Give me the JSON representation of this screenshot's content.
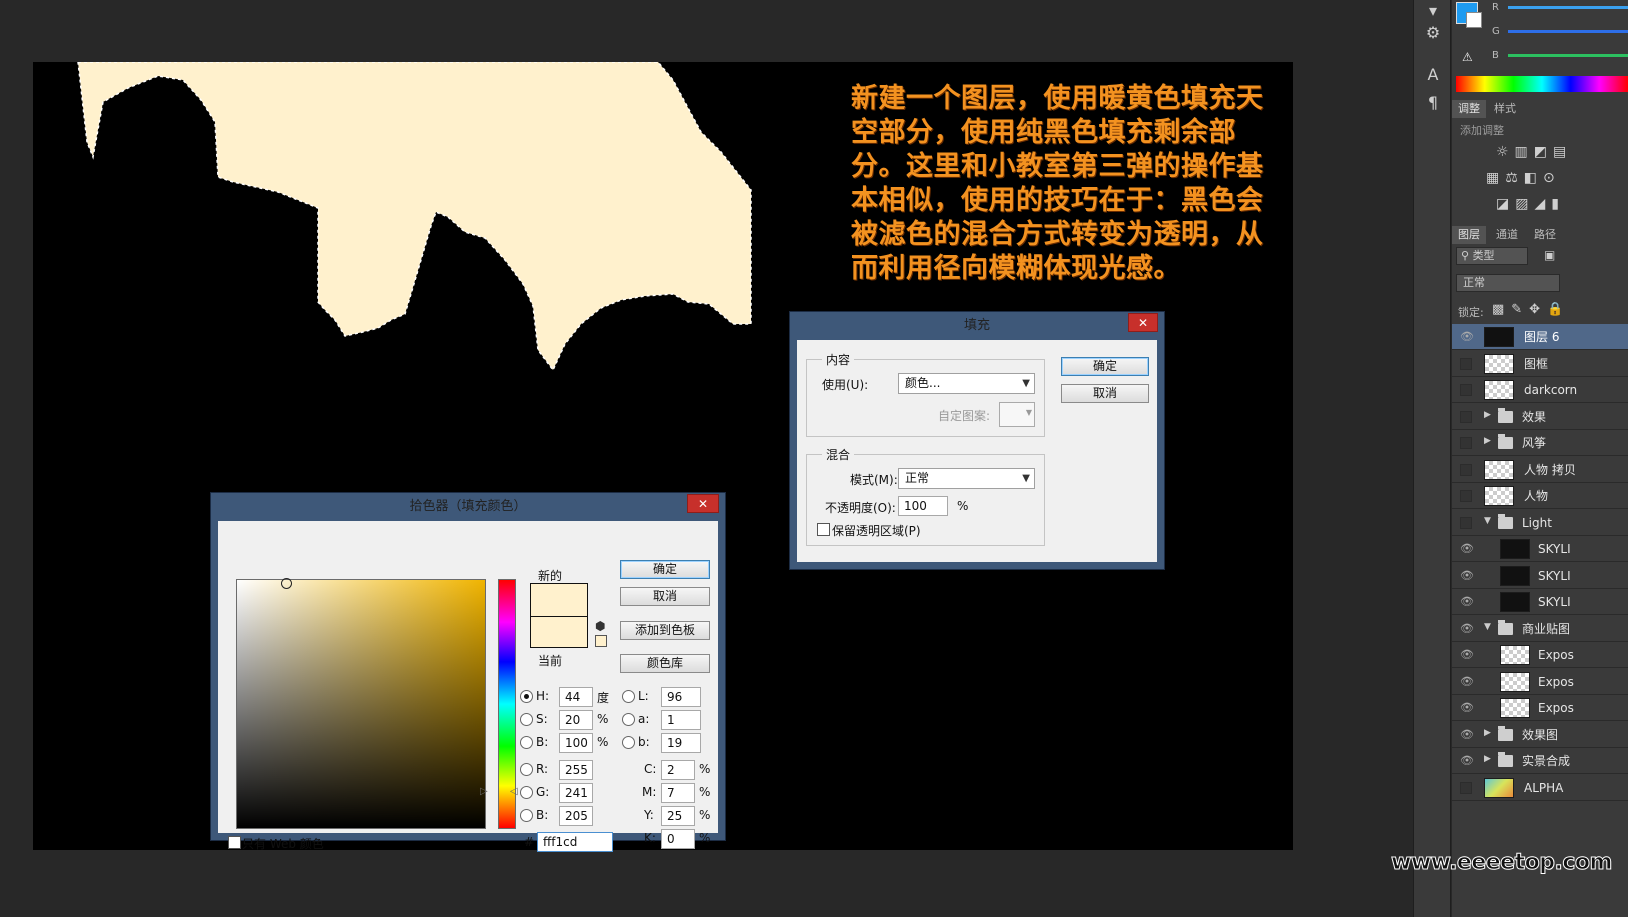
{
  "annotation": {
    "text": "新建一个图层，使用暖黄色填充天空部分，使用纯黑色填充剩余部分。这里和小教室第三弹的操作基本相似，使用的技巧在于：黑色会被滤色的混合方式转变为透明，从而利用径向模糊体现光感。"
  },
  "canvas": {
    "sky_color": "#fff1cd",
    "fill_color": "#000000"
  },
  "color_picker": {
    "title": "拾色器（填充颜色）",
    "close": "✕",
    "new_label": "新的",
    "current_label": "当前",
    "buttons": {
      "ok": "确定",
      "cancel": "取消",
      "add_to_swatches": "添加到色板",
      "color_libraries": "颜色库"
    },
    "fields": {
      "H": {
        "label": "H:",
        "value": "44",
        "unit": "度"
      },
      "S": {
        "label": "S:",
        "value": "20",
        "unit": "%"
      },
      "Bv": {
        "label": "B:",
        "value": "100",
        "unit": "%"
      },
      "R": {
        "label": "R:",
        "value": "255"
      },
      "G": {
        "label": "G:",
        "value": "241"
      },
      "B": {
        "label": "B:",
        "value": "205"
      },
      "L": {
        "label": "L:",
        "value": "96"
      },
      "a": {
        "label": "a:",
        "value": "1"
      },
      "b": {
        "label": "b:",
        "value": "19"
      },
      "C": {
        "label": "C:",
        "value": "2",
        "unit": "%"
      },
      "M": {
        "label": "M:",
        "value": "7",
        "unit": "%"
      },
      "Y": {
        "label": "Y:",
        "value": "25",
        "unit": "%"
      },
      "K": {
        "label": "K:",
        "value": "0",
        "unit": "%"
      }
    },
    "hex_label": "#",
    "hex_value": "fff1cd",
    "web_only_label": "只有 Web 颜色",
    "selected_mode": "H"
  },
  "fill_dialog": {
    "title": "填充",
    "close": "✕",
    "content_group": "内容",
    "use_label": "使用(U):",
    "use_value": "颜色...",
    "custom_pattern_label": "自定图案:",
    "blend_group": "混合",
    "mode_label": "模式(M):",
    "mode_value": "正常",
    "opacity_label": "不透明度(O):",
    "opacity_value": "100",
    "opacity_unit": "%",
    "preserve_label": "保留透明区域(P)",
    "ok": "确定",
    "cancel": "取消"
  },
  "right_panel": {
    "channels": [
      "R",
      "G",
      "B"
    ],
    "adjust_tabs": [
      "调整",
      "样式"
    ],
    "add_adjust_label": "添加调整",
    "layer_tabs": [
      "图层",
      "通道",
      "路径"
    ],
    "filter_label": "类型",
    "blend_mode": "正常",
    "lock_label": "锁定:",
    "layers": [
      {
        "name": "图层 6",
        "kind": "dark",
        "visible": true,
        "selected": true
      },
      {
        "name": "图框",
        "kind": "checker",
        "visible": false
      },
      {
        "name": "darkcorn",
        "kind": "checker",
        "visible": false
      },
      {
        "name": "效果",
        "kind": "folder",
        "visible": false,
        "expanded": false
      },
      {
        "name": "风筝",
        "kind": "folder",
        "visible": false,
        "expanded": false
      },
      {
        "name": "人物 拷贝",
        "kind": "checker",
        "visible": false
      },
      {
        "name": "人物",
        "kind": "checker",
        "visible": false
      },
      {
        "name": "Light",
        "kind": "folder",
        "visible": false,
        "expanded": true
      },
      {
        "name": "SKYLI",
        "kind": "dark",
        "visible": true,
        "indent": true
      },
      {
        "name": "SKYLI",
        "kind": "dark",
        "visible": true,
        "indent": true
      },
      {
        "name": "SKYLI",
        "kind": "dark",
        "visible": true,
        "indent": true
      },
      {
        "name": "商业贴图",
        "kind": "folder",
        "visible": true,
        "expanded": true
      },
      {
        "name": "Expos",
        "kind": "checker",
        "visible": true,
        "indent": true
      },
      {
        "name": "Expos",
        "kind": "checker",
        "visible": true,
        "indent": true
      },
      {
        "name": "Expos",
        "kind": "checker",
        "visible": true,
        "indent": true
      },
      {
        "name": "效果图",
        "kind": "folder",
        "visible": true,
        "expanded": false
      },
      {
        "name": "实景合成",
        "kind": "folder",
        "visible": true,
        "expanded": false
      },
      {
        "name": "ALPHA",
        "kind": "colorful",
        "visible": false
      }
    ]
  },
  "watermark": "www.eeeetop.com"
}
